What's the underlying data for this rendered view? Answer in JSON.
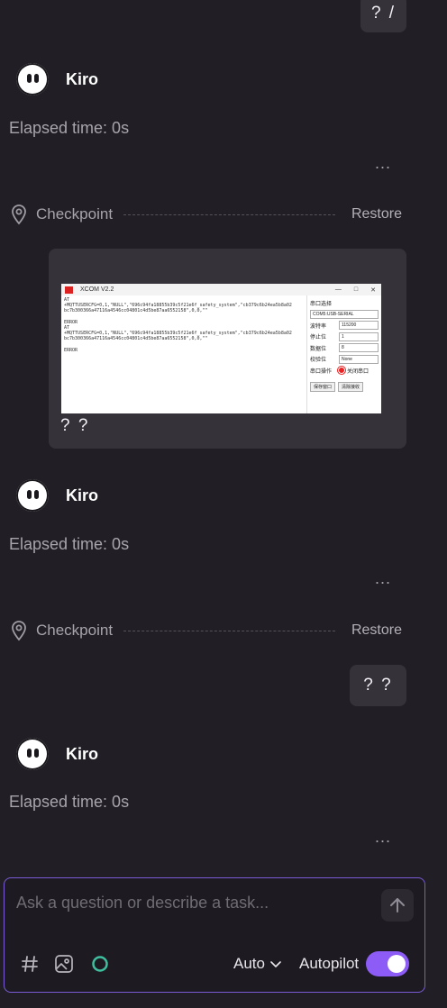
{
  "messages": {
    "user_1": "? /",
    "user_2": "? ?",
    "user_3": "? ?"
  },
  "assistant": {
    "name": "Kiro",
    "elapsed": "Elapsed time: 0s",
    "more": "..."
  },
  "checkpoint": {
    "label": "Checkpoint",
    "restore": "Restore"
  },
  "attachment": {
    "window_title": "XCOM V2.2",
    "log_text": "AT\n+MQTTUSERCFG=0,1,\"NULL\",\"696c94fa18855b39c5f21e6f_safety_system\",\"cb379c6b24ea5b8a02\nbc7b300366a47116a4546cc04801c4d5be87aa6552158\",0,0,\"\"\n\nERROR\nAT\n+MQTTUSERCFG=0,1,\"NULL\",\"696c94fa18855b39c5f21e6f_safety_system\",\"cb379c6b24ea5b8a02\nbc7b300366a47116a4546cc04801c4d5be87aa6552158\",0,0,\"\"\n\nERROR",
    "side": {
      "port_select_label": "串口选择",
      "port_value": "COM5:USB-SERIAL",
      "baud_label": "波特率",
      "baud_value": "115200",
      "stop_label": "停止位",
      "stop_value": "1",
      "data_label": "数据位",
      "data_value": "8",
      "parity_label": "校验位",
      "parity_value": "None",
      "op_label": "串口操作",
      "op_button": "关闭串口",
      "save_btn": "保存窗口",
      "clear_btn": "清除接收"
    }
  },
  "composer": {
    "placeholder": "Ask a question or describe a task...",
    "mode": "Auto",
    "autopilot_label": "Autopilot",
    "autopilot_on": true
  },
  "colors": {
    "background": "#211f25",
    "bubble": "#353339",
    "accent": "#8d5cf6",
    "composer_border": "#7a5bd6",
    "spinner": "#3fbf9f"
  },
  "icons": {
    "pin": "map-pin-icon",
    "send": "arrow-up-icon",
    "context": "hash-icon",
    "image": "image-icon",
    "status": "spinner-icon",
    "chevron": "chevron-down-icon"
  }
}
